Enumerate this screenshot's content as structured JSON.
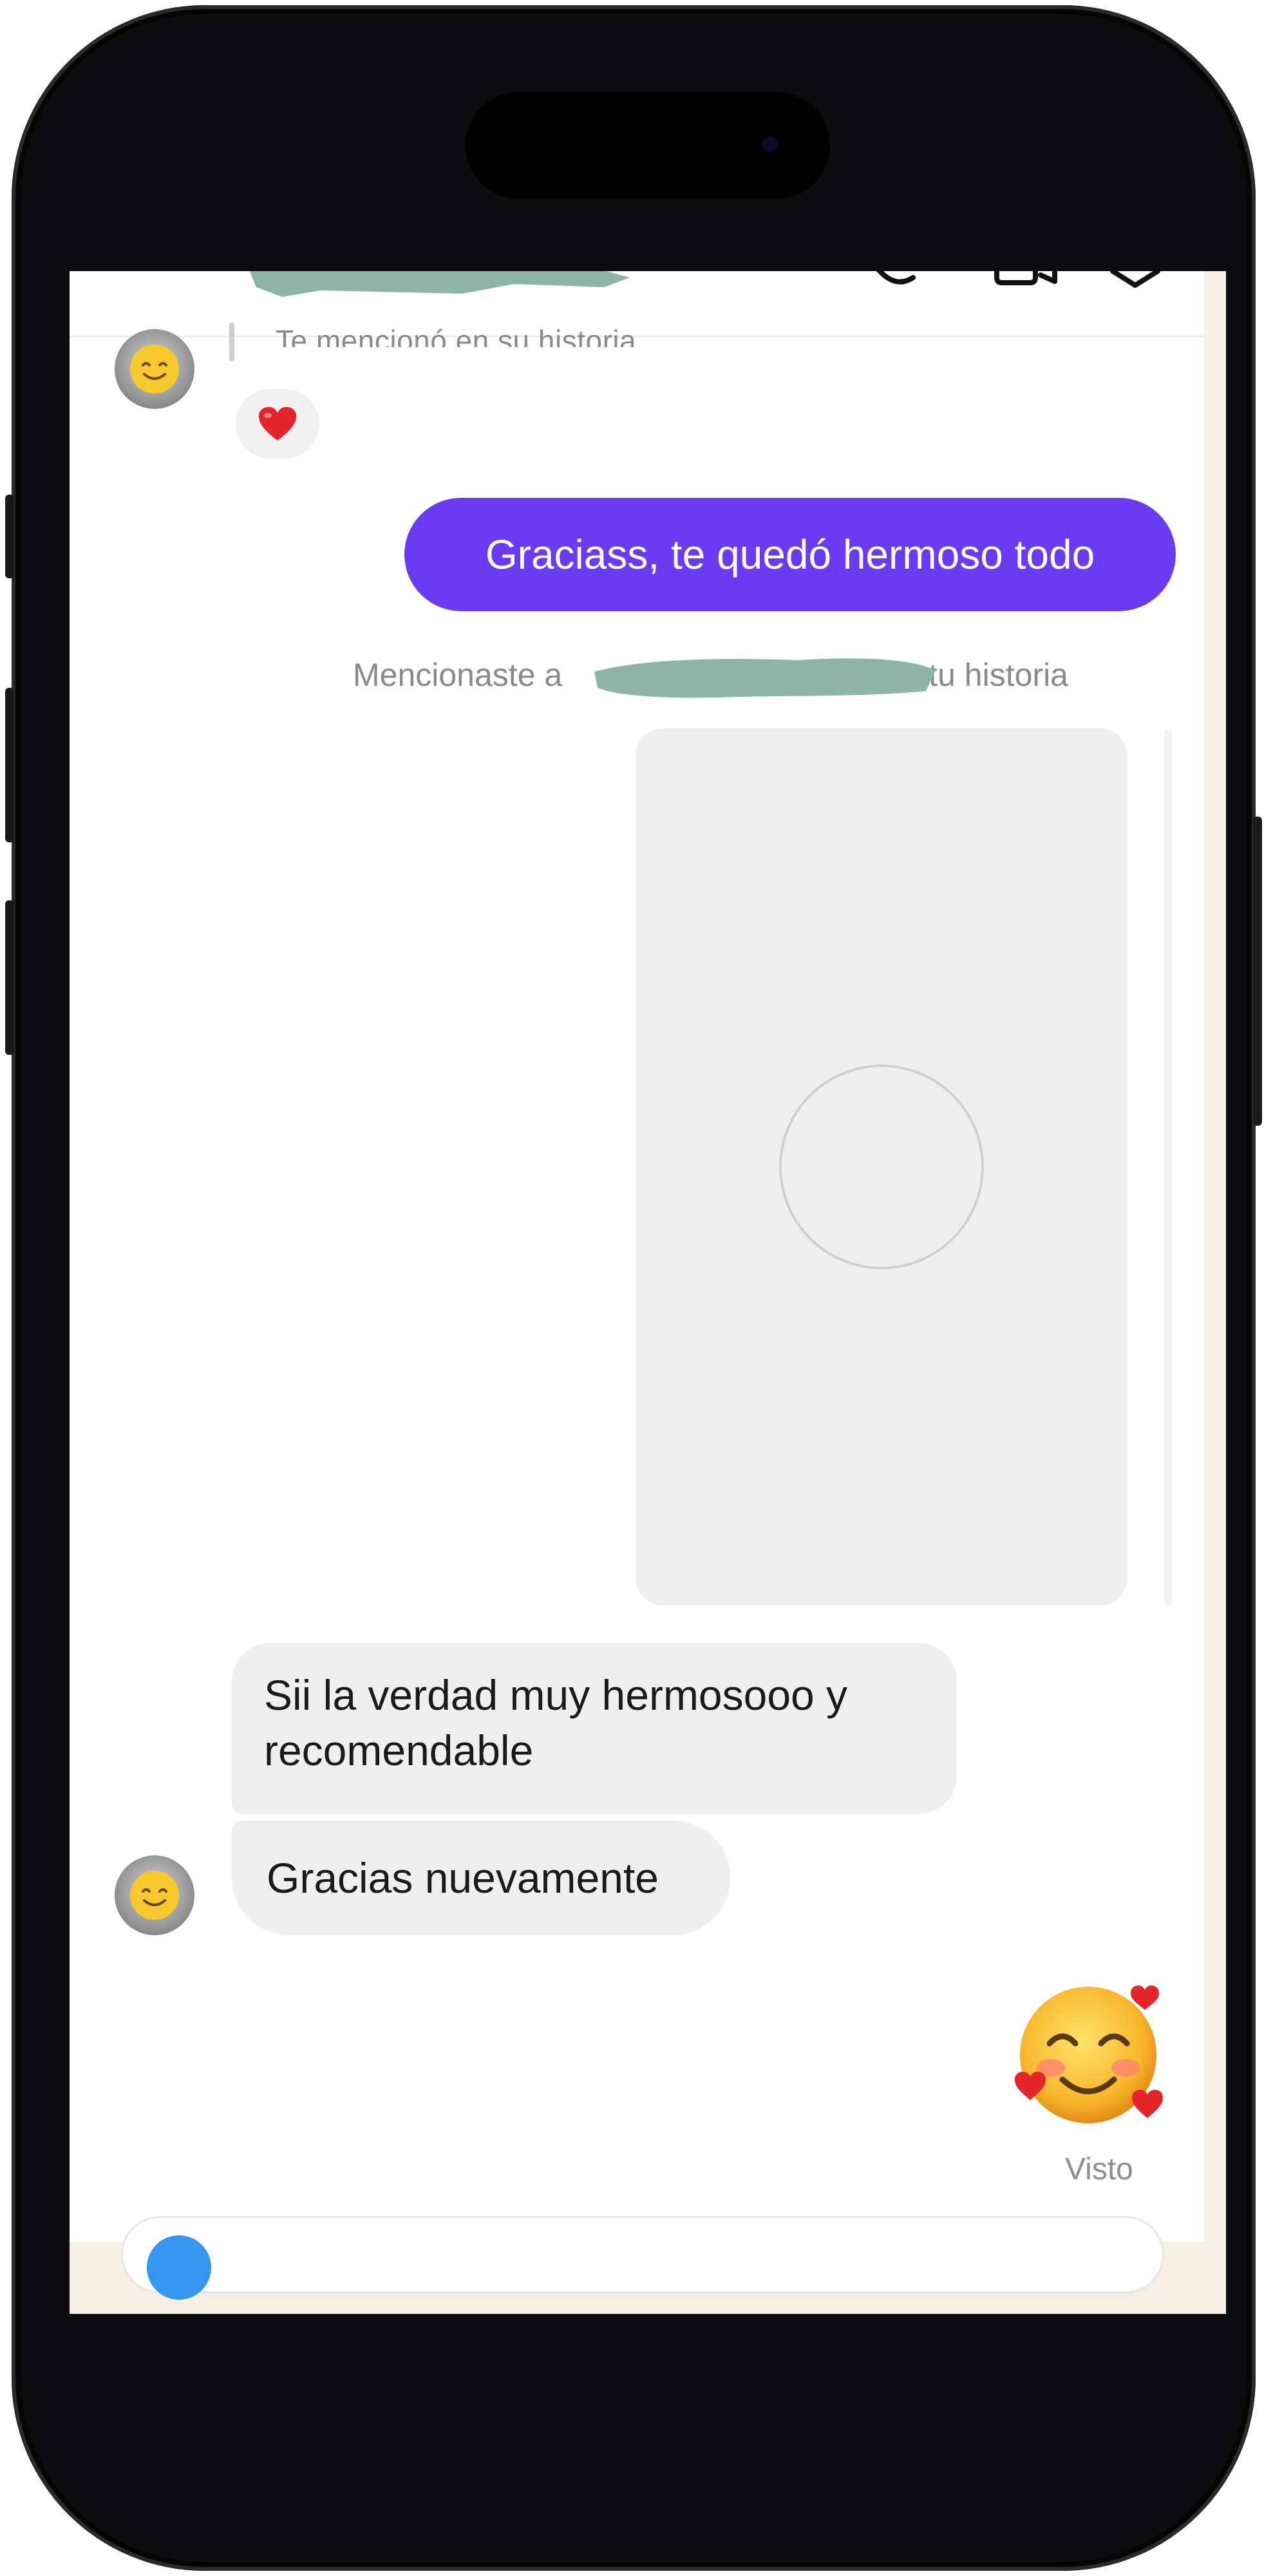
{
  "conversation": {
    "mention_received": "Te mencionó en su historia",
    "reaction_icon": "heart-emoji",
    "outgoing_message": "Graciass, te quedó hermoso todo",
    "mention_sent_prefix": "Mencionaste a",
    "mention_sent_suffix": "o_ en tu historia",
    "incoming_messages": [
      "Sii la verdad muy hermosooo y recomendable",
      "Gracias nuevamente"
    ],
    "sent_sticker": "smiling-face-with-hearts-emoji",
    "seen_status": "Visto"
  },
  "colors": {
    "outgoing_bubble": "#6a3bf2",
    "incoming_bubble": "#efefef",
    "redaction": "#8fb5a8"
  }
}
